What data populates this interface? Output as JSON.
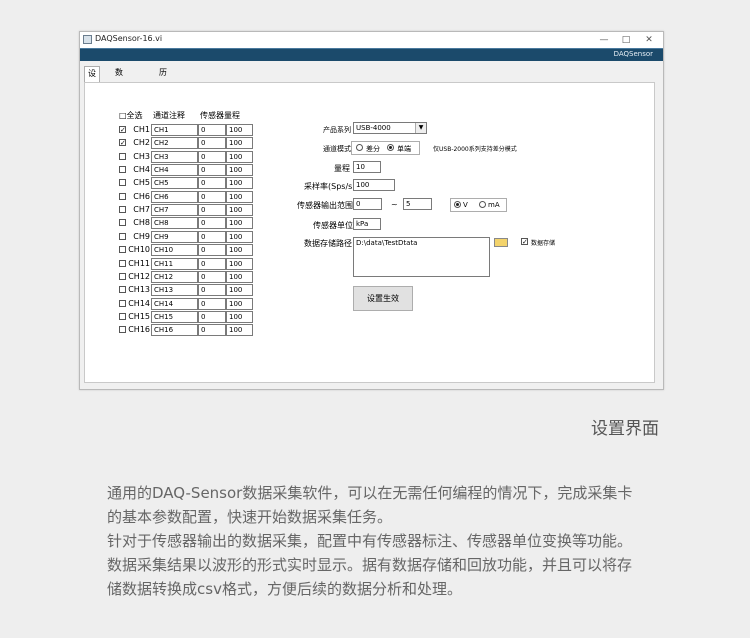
{
  "window": {
    "title": "DAQSensor-16.vi",
    "banner": "DAQSensor",
    "minimize": "—",
    "maximize": "□",
    "close": "✕"
  },
  "tabs": [
    "设置",
    "数据采集",
    "历史数据"
  ],
  "table": {
    "select_all": "□全选",
    "col_note": "通道注释",
    "col_range": "传感器量程",
    "rows": [
      {
        "ch": "CH1",
        "note": "CH1",
        "min": "0",
        "max": "100",
        "checked": true
      },
      {
        "ch": "CH2",
        "note": "CH2",
        "min": "0",
        "max": "100",
        "checked": true
      },
      {
        "ch": "CH3",
        "note": "CH3",
        "min": "0",
        "max": "100",
        "checked": false
      },
      {
        "ch": "CH4",
        "note": "CH4",
        "min": "0",
        "max": "100",
        "checked": false
      },
      {
        "ch": "CH5",
        "note": "CH5",
        "min": "0",
        "max": "100",
        "checked": false
      },
      {
        "ch": "CH6",
        "note": "CH6",
        "min": "0",
        "max": "100",
        "checked": false
      },
      {
        "ch": "CH7",
        "note": "CH7",
        "min": "0",
        "max": "100",
        "checked": false
      },
      {
        "ch": "CH8",
        "note": "CH8",
        "min": "0",
        "max": "100",
        "checked": false
      },
      {
        "ch": "CH9",
        "note": "CH9",
        "min": "0",
        "max": "100",
        "checked": false
      },
      {
        "ch": "CH10",
        "note": "CH10",
        "min": "0",
        "max": "100",
        "checked": false
      },
      {
        "ch": "CH11",
        "note": "CH11",
        "min": "0",
        "max": "100",
        "checked": false
      },
      {
        "ch": "CH12",
        "note": "CH12",
        "min": "0",
        "max": "100",
        "checked": false
      },
      {
        "ch": "CH13",
        "note": "CH13",
        "min": "0",
        "max": "100",
        "checked": false
      },
      {
        "ch": "CH14",
        "note": "CH14",
        "min": "0",
        "max": "100",
        "checked": false
      },
      {
        "ch": "CH15",
        "note": "CH15",
        "min": "0",
        "max": "100",
        "checked": false
      },
      {
        "ch": "CH16",
        "note": "CH16",
        "min": "0",
        "max": "100",
        "checked": false
      }
    ]
  },
  "form": {
    "product_label": "产品系列",
    "product_value": "USB-4000",
    "mode_label": "通道模式",
    "mode_diff": "差分",
    "mode_single": "单端",
    "mode_note": "仅USB-2000系列支持差分模式",
    "range_label": "量程",
    "range_value": "10",
    "rate_label": "采样率(Sps/s)",
    "rate_value": "100",
    "output_label": "传感器输出范围",
    "output_min": "0",
    "output_tilde": "~",
    "output_max": "5",
    "unit_v": "V",
    "unit_ma": "mA",
    "unit_label": "传感器单位",
    "unit_value": "kPa",
    "path_label": "数据存储路径",
    "path_value": "D:\\data\\TestDtata",
    "store_label": "数据存储",
    "apply_label": "设置生效"
  },
  "caption": "设置界面",
  "description": [
    "通用的DAQ-Sensor数据采集软件，可以在无需任何编程的情况下，完成采集卡的基本参数配置，快速开始数据采集任务。",
    "针对于传感器输出的数据采集，配置中有传感器标注、传感器单位变换等功能。",
    "数据采集结果以波形的形式实时显示。据有数据存储和回放功能，并且可以将存储数据转换成csv格式，方便后续的数据分析和处理。"
  ]
}
